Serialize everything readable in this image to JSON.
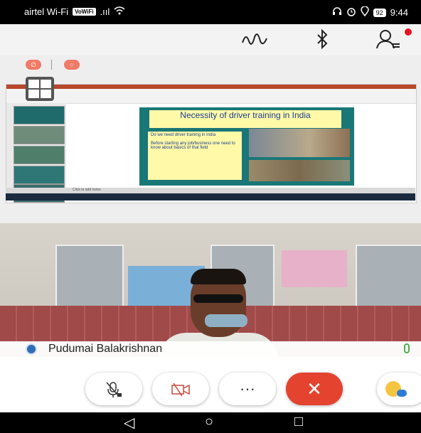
{
  "status_bar": {
    "carrier": "airtel Wi-Fi",
    "volte_badge": "VoWiFi",
    "signal": ".ııl",
    "wifi_icon": "wifi-icon",
    "battery": "92",
    "time": "9:44"
  },
  "top_bar": {
    "icons": [
      "pen-scribble-icon",
      "bluetooth-icon",
      "participants-icon"
    ],
    "notification_color": "#e81224"
  },
  "shared_screen": {
    "slide_title": "Necessity of driver training in India",
    "bullets": [
      "Do we need driver training in India",
      "Before starting any job/business one need to know about basics of that field"
    ],
    "ppt_status": "Click to add notes"
  },
  "video": {
    "participant_name": "Pudumai Balakrishnan"
  },
  "controls": {
    "mute_label": "",
    "video_label": "",
    "more_label": "···",
    "end_label": "✕",
    "accent": "#e4432f"
  },
  "nav": {
    "back": "◁",
    "home": "○",
    "recents": "□"
  }
}
